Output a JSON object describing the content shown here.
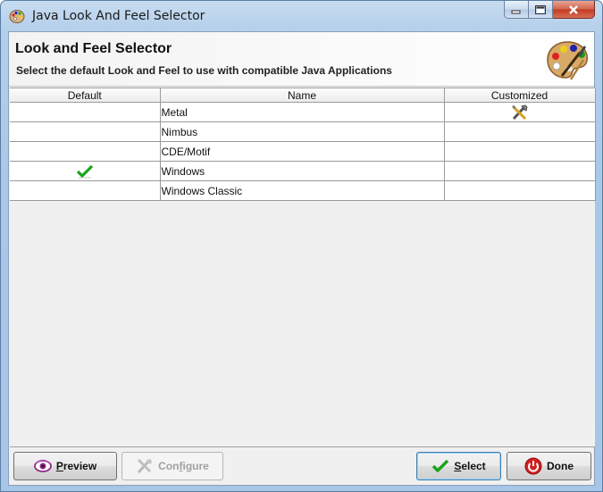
{
  "window": {
    "title": "Java Look And Feel Selector",
    "icon": "palette-icon",
    "controls": [
      "minimize-icon",
      "maximize-icon",
      "close-icon"
    ]
  },
  "header": {
    "title": "Look and Feel Selector",
    "subtitle": "Select the default Look and Feel to use with compatible Java Applications",
    "icon": "palette-icon"
  },
  "table": {
    "columns": [
      "Default",
      "Name",
      "Customized"
    ],
    "rows": [
      {
        "default": false,
        "name": "Metal",
        "customized": true
      },
      {
        "default": false,
        "name": "Nimbus",
        "customized": false
      },
      {
        "default": false,
        "name": "CDE/Motif",
        "customized": false
      },
      {
        "default": true,
        "name": "Windows",
        "customized": false
      },
      {
        "default": false,
        "name": "Windows Classic",
        "customized": false
      }
    ]
  },
  "buttons": {
    "preview": {
      "label": "Preview",
      "mnemonic": "P",
      "rest": "review",
      "icon": "eye-icon",
      "enabled": true
    },
    "configure": {
      "label": "Configure",
      "mnemonic": "f",
      "pre": "Con",
      "rest": "igure",
      "icon": "tools-icon",
      "enabled": false
    },
    "select": {
      "label": "Select",
      "mnemonic": "S",
      "rest": "elect",
      "icon": "checkmark-icon",
      "enabled": true,
      "default": true
    },
    "done": {
      "label": "Done",
      "icon": "power-icon",
      "enabled": true
    }
  },
  "colors": {
    "check": "#1aa31a",
    "power": "#d42020",
    "eye": "#8a2a8a"
  }
}
